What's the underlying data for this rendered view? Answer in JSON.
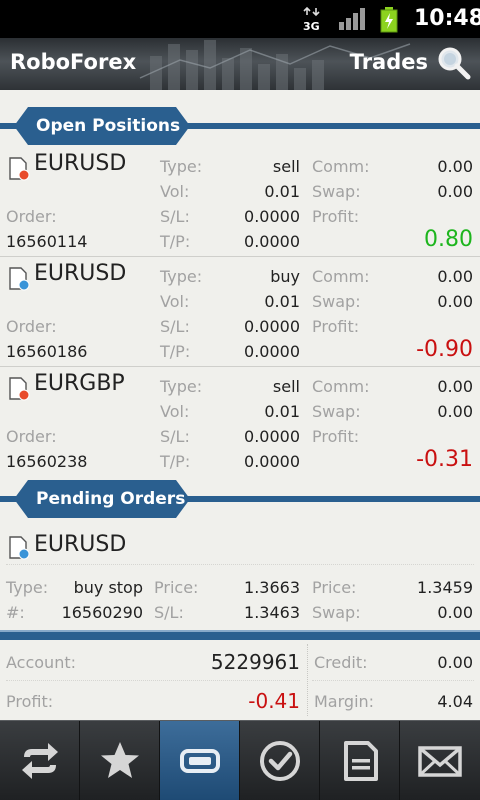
{
  "status_bar": {
    "network": "3G",
    "time": "10:48"
  },
  "header": {
    "app_title": "RoboForex",
    "page_title": "Trades"
  },
  "labels": {
    "type": "Type:",
    "vol": "Vol:",
    "sl": "S/L:",
    "tp": "T/P:",
    "comm": "Comm:",
    "swap": "Swap:",
    "profit": "Profit:",
    "order": "Order:",
    "price": "Price:",
    "hash": "#:"
  },
  "open_positions": {
    "title": "Open Positions",
    "items": [
      {
        "symbol": "EURUSD",
        "direction_icon": "sell-icon",
        "order": "16560114",
        "type": "sell",
        "vol": "0.01",
        "sl": "0.0000",
        "tp": "0.0000",
        "comm": "0.00",
        "swap": "0.00",
        "profit": "0.80"
      },
      {
        "symbol": "EURUSD",
        "direction_icon": "buy-icon",
        "order": "16560186",
        "type": "buy",
        "vol": "0.01",
        "sl": "0.0000",
        "tp": "0.0000",
        "comm": "0.00",
        "swap": "0.00",
        "profit": "-0.90"
      },
      {
        "symbol": "EURGBP",
        "direction_icon": "sell-icon",
        "order": "16560238",
        "type": "sell",
        "vol": "0.01",
        "sl": "0.0000",
        "tp": "0.0000",
        "comm": "0.00",
        "swap": "0.00",
        "profit": "-0.31"
      }
    ]
  },
  "pending_orders": {
    "title": "Pending Orders",
    "items": [
      {
        "symbol": "EURUSD",
        "direction_icon": "buy-icon",
        "type": "buy stop",
        "order": "16560290",
        "price": "1.3663",
        "sl": "1.3463",
        "market_price": "1.3459",
        "swap": "0.00"
      }
    ]
  },
  "summary": {
    "account_label": "Account:",
    "account": "5229961",
    "credit_label": "Credit:",
    "credit": "0.00",
    "profit_label": "Profit:",
    "profit": "-0.41",
    "margin_label": "Margin:",
    "margin": "4.04"
  },
  "toolbar": {
    "items": [
      "exchange-arrows-icon",
      "star-icon",
      "trades-icon",
      "checkmark-icon",
      "document-icon",
      "mail-icon"
    ],
    "active": "trades-icon"
  },
  "colors": {
    "accent": "#2a5f8f",
    "profit_positive": "#1db51d",
    "profit_negative": "#c91010"
  }
}
